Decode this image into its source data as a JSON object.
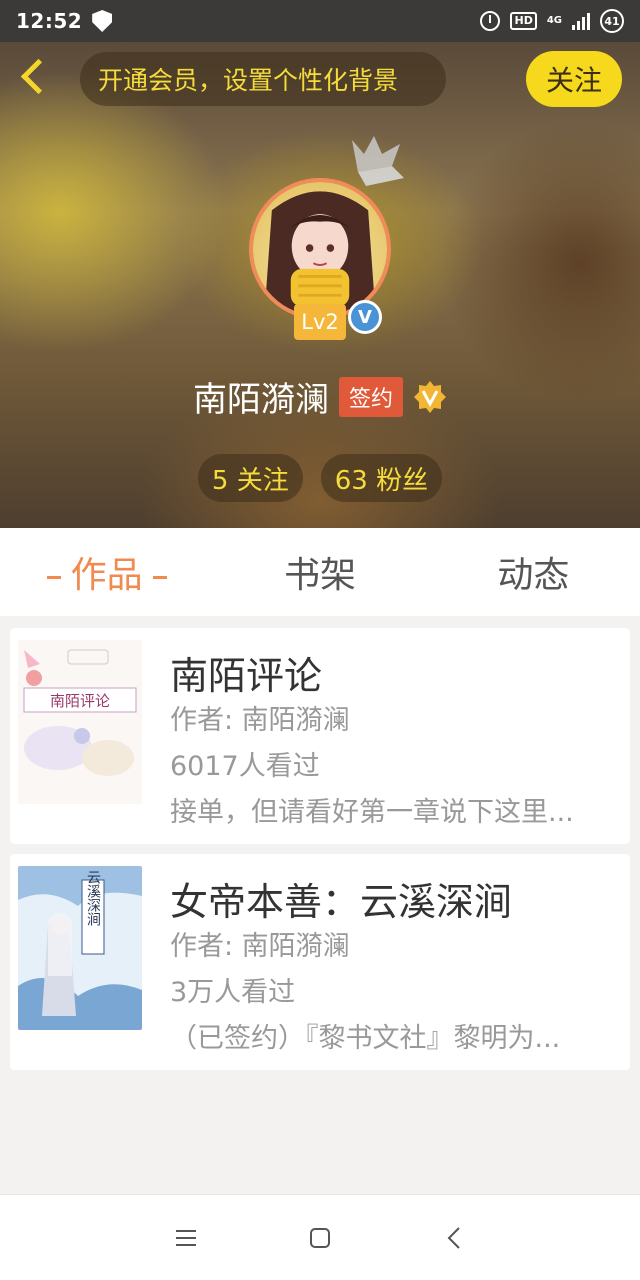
{
  "status_bar": {
    "time": "12:52",
    "network": "4G",
    "hd": "HD",
    "battery": "41"
  },
  "header": {
    "vip_banner": "开通会员，设置个性化背景",
    "follow_label": "关注",
    "level": "Lv2",
    "verified_mark": "V",
    "user_name": "南陌漪澜",
    "signed_label": "签约",
    "stats": {
      "following": "5 关注",
      "followers": "63 粉丝"
    }
  },
  "tabs": [
    {
      "label": "作品",
      "active": true
    },
    {
      "label": "书架",
      "active": false
    },
    {
      "label": "动态",
      "active": false
    }
  ],
  "books": [
    {
      "title": "南陌评论",
      "author": "作者: 南陌漪澜",
      "views": "6017人看过",
      "summary": "接单，但请看好第一章说下这里...",
      "cover_text": "南陌评论"
    },
    {
      "title": "女帝本善：云溪深涧",
      "author": "作者: 南陌漪澜",
      "views": "3万人看过",
      "summary": "（已签约）『黎书文社』黎明为...",
      "cover_text": "云溪深涧"
    }
  ],
  "colors": {
    "accent_orange": "#f08a4f",
    "accent_yellow": "#f6d91c",
    "signed_red": "#e05a3a"
  }
}
